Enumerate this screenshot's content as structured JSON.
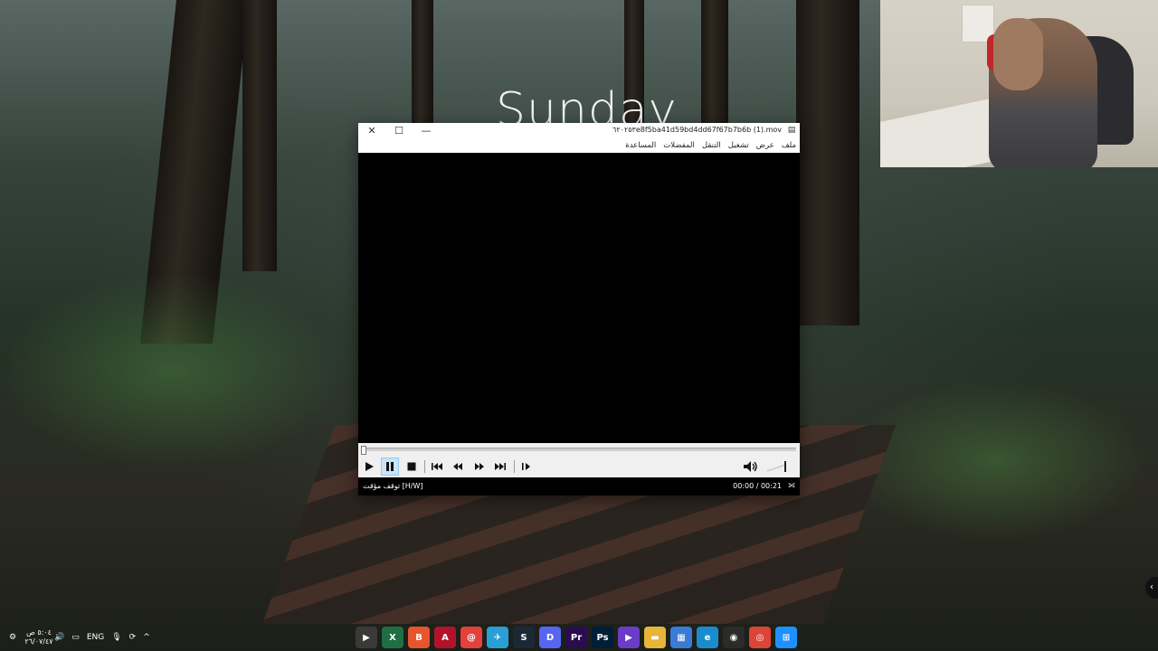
{
  "wallpaper": {
    "day": "Sunday"
  },
  "player": {
    "title": "٦٢٠٢٥٣e8f5ba41d59bd4dd67f67b7b6b (1).mov",
    "menu": [
      "ملف",
      "عرض",
      "تشغيل",
      "التنقل",
      "المفضلات",
      "المساعدة"
    ],
    "window_buttons": {
      "minimize": "—",
      "maximize": "☐",
      "close": "✕"
    },
    "status": {
      "left": "توقف مؤقت [H/W]",
      "right": "00:00 / 00:21"
    },
    "controls": [
      "play",
      "pause",
      "stop",
      "prev",
      "rewind",
      "forward",
      "next",
      "frame-step"
    ],
    "progress_fraction": 0.0
  },
  "taskbar": {
    "language": "ENG",
    "clock": {
      "time": "٥:٠٤ ص",
      "date": "٢٦/٠٧/٤٧"
    },
    "apps": [
      {
        "name": "mpc-icon",
        "label": "▶",
        "color": "#3a3a3a"
      },
      {
        "name": "excel-icon",
        "label": "X",
        "color": "#1e6f43"
      },
      {
        "name": "brave-icon",
        "label": "B",
        "color": "#e7552d"
      },
      {
        "name": "acrobat-icon",
        "label": "A",
        "color": "#b3122c"
      },
      {
        "name": "app-red-icon",
        "label": "@",
        "color": "#e4413b"
      },
      {
        "name": "telegram-icon",
        "label": "✈",
        "color": "#2a9fd6"
      },
      {
        "name": "steam-icon",
        "label": "S",
        "color": "#1b2838"
      },
      {
        "name": "discord-icon",
        "label": "D",
        "color": "#5865f2"
      },
      {
        "name": "premiere-icon",
        "label": "Pr",
        "color": "#2b0c4f"
      },
      {
        "name": "photoshop-icon",
        "label": "Ps",
        "color": "#001e36"
      },
      {
        "name": "video-editor-icon",
        "label": "▶",
        "color": "#6b3cc9"
      },
      {
        "name": "file-explorer-icon",
        "label": "▬",
        "color": "#e8b53a"
      },
      {
        "name": "store-icon",
        "label": "▦",
        "color": "#3a7bd5"
      },
      {
        "name": "edge-icon",
        "label": "e",
        "color": "#1a8ccd"
      },
      {
        "name": "obs-icon",
        "label": "◉",
        "color": "#2b2b2b"
      },
      {
        "name": "chrome-icon",
        "label": "◎",
        "color": "#db4437"
      },
      {
        "name": "start-icon",
        "label": "⊞",
        "color": "#1e90ff"
      }
    ]
  }
}
